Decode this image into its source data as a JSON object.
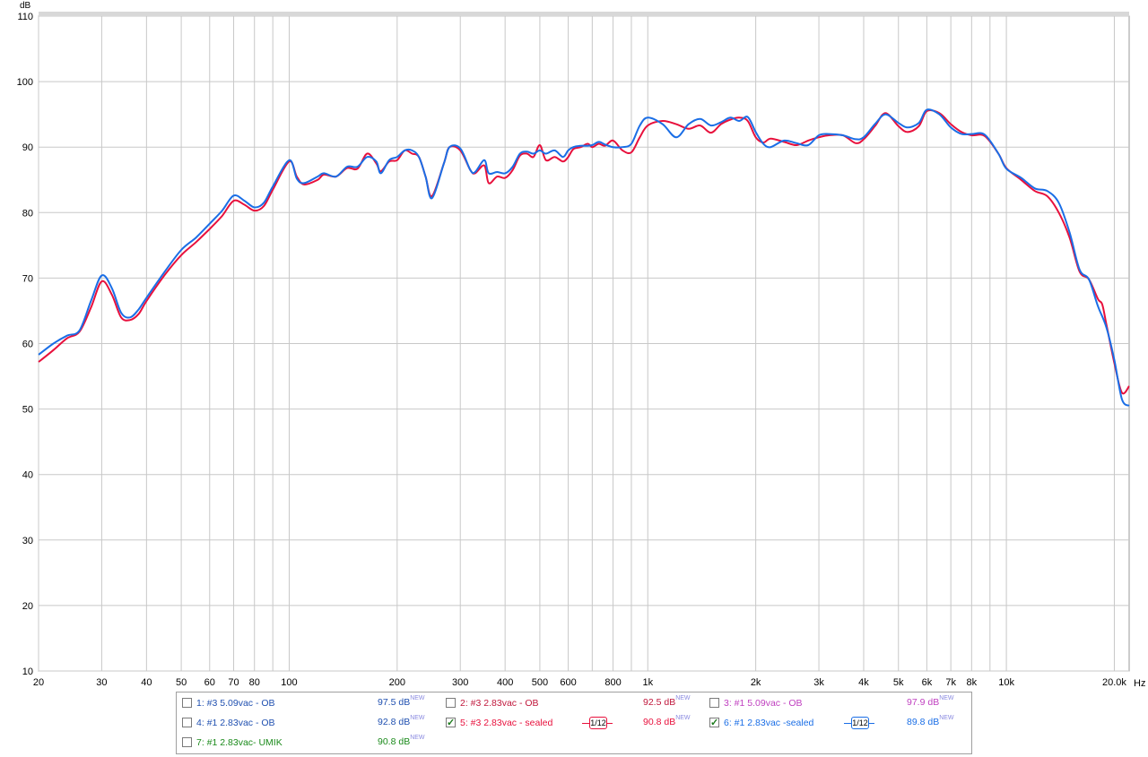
{
  "chart_data": {
    "type": "line",
    "ylabel": "dB",
    "xunit": "Hz",
    "xscale": "log",
    "xlim": [
      20,
      22000
    ],
    "ylim": [
      10,
      110
    ],
    "grid": true,
    "y_ticks": [
      10,
      20,
      30,
      40,
      50,
      60,
      70,
      80,
      90,
      100,
      110
    ],
    "x_ticks": [
      {
        "v": 20,
        "label": "20"
      },
      {
        "v": 30,
        "label": "30"
      },
      {
        "v": 40,
        "label": "40"
      },
      {
        "v": 50,
        "label": "50"
      },
      {
        "v": 60,
        "label": "60"
      },
      {
        "v": 70,
        "label": "70"
      },
      {
        "v": 80,
        "label": "80"
      },
      {
        "v": 100,
        "label": "100"
      },
      {
        "v": 200,
        "label": "200"
      },
      {
        "v": 300,
        "label": "300"
      },
      {
        "v": 400,
        "label": "400"
      },
      {
        "v": 500,
        "label": "500"
      },
      {
        "v": 600,
        "label": "600"
      },
      {
        "v": 800,
        "label": "800"
      },
      {
        "v": 1000,
        "label": "1k"
      },
      {
        "v": 2000,
        "label": "2k"
      },
      {
        "v": 3000,
        "label": "3k"
      },
      {
        "v": 4000,
        "label": "4k"
      },
      {
        "v": 5000,
        "label": "5k"
      },
      {
        "v": 6000,
        "label": "6k"
      },
      {
        "v": 7000,
        "label": "7k"
      },
      {
        "v": 8000,
        "label": "8k"
      },
      {
        "v": 10000,
        "label": "10k"
      },
      {
        "v": 20000,
        "label": "20.0k"
      }
    ],
    "x_gridlines": [
      20,
      30,
      40,
      50,
      60,
      70,
      80,
      90,
      100,
      200,
      300,
      400,
      500,
      600,
      700,
      800,
      900,
      1000,
      2000,
      3000,
      4000,
      5000,
      6000,
      7000,
      8000,
      9000,
      10000,
      20000
    ],
    "series": [
      {
        "name": "5: #3 2.83vac - sealed",
        "color": "#e8103c",
        "points": [
          [
            20,
            57.2
          ],
          [
            22,
            59
          ],
          [
            24,
            60.8
          ],
          [
            26,
            61.8
          ],
          [
            28,
            65.5
          ],
          [
            30,
            69.5
          ],
          [
            32,
            67.5
          ],
          [
            34,
            64
          ],
          [
            36,
            63.6
          ],
          [
            38,
            64.5
          ],
          [
            40,
            66.5
          ],
          [
            45,
            70.5
          ],
          [
            50,
            73.5
          ],
          [
            55,
            75.5
          ],
          [
            60,
            77.5
          ],
          [
            65,
            79.5
          ],
          [
            70,
            81.8
          ],
          [
            75,
            81.2
          ],
          [
            80,
            80.3
          ],
          [
            85,
            81
          ],
          [
            90,
            83.5
          ],
          [
            100,
            87.8
          ],
          [
            105,
            85.5
          ],
          [
            110,
            84.3
          ],
          [
            120,
            85
          ],
          [
            125,
            85.8
          ],
          [
            135,
            85.5
          ],
          [
            145,
            86.8
          ],
          [
            155,
            86.7
          ],
          [
            165,
            89
          ],
          [
            175,
            87.5
          ],
          [
            180,
            86.3
          ],
          [
            190,
            87.8
          ],
          [
            200,
            88
          ],
          [
            210,
            89.5
          ],
          [
            220,
            89
          ],
          [
            230,
            88.5
          ],
          [
            240,
            85.5
          ],
          [
            250,
            82.5
          ],
          [
            270,
            87.5
          ],
          [
            280,
            90
          ],
          [
            300,
            89.5
          ],
          [
            320,
            86.5
          ],
          [
            330,
            86
          ],
          [
            350,
            87.2
          ],
          [
            360,
            84.5
          ],
          [
            380,
            85.5
          ],
          [
            400,
            85.3
          ],
          [
            420,
            86.5
          ],
          [
            440,
            88.7
          ],
          [
            460,
            89
          ],
          [
            480,
            88.5
          ],
          [
            500,
            90.3
          ],
          [
            520,
            88
          ],
          [
            550,
            88.5
          ],
          [
            580,
            87.8
          ],
          [
            600,
            88.5
          ],
          [
            620,
            89.7
          ],
          [
            650,
            90
          ],
          [
            680,
            90.5
          ],
          [
            700,
            90
          ],
          [
            730,
            90.5
          ],
          [
            760,
            90.2
          ],
          [
            800,
            91
          ],
          [
            850,
            89.5
          ],
          [
            900,
            89.2
          ],
          [
            950,
            91.5
          ],
          [
            1000,
            93.3
          ],
          [
            1100,
            94
          ],
          [
            1200,
            93.5
          ],
          [
            1300,
            92.8
          ],
          [
            1400,
            93.3
          ],
          [
            1500,
            92.2
          ],
          [
            1600,
            93.5
          ],
          [
            1700,
            94.2
          ],
          [
            1800,
            94.5
          ],
          [
            1900,
            94
          ],
          [
            2000,
            91.5
          ],
          [
            2100,
            90.7
          ],
          [
            2200,
            91.3
          ],
          [
            2400,
            90.8
          ],
          [
            2600,
            90.3
          ],
          [
            2800,
            91
          ],
          [
            3000,
            91.5
          ],
          [
            3200,
            91.8
          ],
          [
            3500,
            91.8
          ],
          [
            3800,
            90.6
          ],
          [
            4000,
            91.2
          ],
          [
            4300,
            93.2
          ],
          [
            4600,
            95.2
          ],
          [
            5000,
            93.2
          ],
          [
            5300,
            92.3
          ],
          [
            5700,
            93.2
          ],
          [
            6000,
            95.5
          ],
          [
            6500,
            95.2
          ],
          [
            7000,
            93.5
          ],
          [
            7500,
            92.3
          ],
          [
            8000,
            91.8
          ],
          [
            8700,
            91.7
          ],
          [
            9500,
            89
          ],
          [
            10000,
            86.8
          ],
          [
            11000,
            85
          ],
          [
            12000,
            83.3
          ],
          [
            13000,
            82.5
          ],
          [
            14000,
            80
          ],
          [
            15000,
            76.2
          ],
          [
            16000,
            71
          ],
          [
            17000,
            69.8
          ],
          [
            18000,
            66.8
          ],
          [
            18500,
            66
          ],
          [
            19000,
            63
          ],
          [
            20000,
            57
          ],
          [
            21000,
            52.5
          ],
          [
            22000,
            53.5
          ]
        ]
      },
      {
        "name": "6: #1 2.83vac -sealed",
        "color": "#1a6ee6",
        "points": [
          [
            20,
            58.3
          ],
          [
            22,
            60
          ],
          [
            24,
            61.2
          ],
          [
            26,
            62
          ],
          [
            28,
            66.5
          ],
          [
            30,
            70.4
          ],
          [
            32,
            68.5
          ],
          [
            34,
            64.7
          ],
          [
            36,
            64
          ],
          [
            38,
            65.2
          ],
          [
            40,
            67
          ],
          [
            45,
            71
          ],
          [
            50,
            74.3
          ],
          [
            55,
            76.2
          ],
          [
            60,
            78.3
          ],
          [
            65,
            80.3
          ],
          [
            70,
            82.6
          ],
          [
            75,
            81.8
          ],
          [
            80,
            80.8
          ],
          [
            85,
            81.5
          ],
          [
            90,
            84
          ],
          [
            100,
            88
          ],
          [
            105,
            85.2
          ],
          [
            110,
            84.5
          ],
          [
            120,
            85.5
          ],
          [
            125,
            86
          ],
          [
            135,
            85.5
          ],
          [
            145,
            87
          ],
          [
            155,
            87
          ],
          [
            165,
            88.5
          ],
          [
            175,
            87.8
          ],
          [
            180,
            86
          ],
          [
            190,
            88
          ],
          [
            200,
            88.5
          ],
          [
            210,
            89.5
          ],
          [
            220,
            89.5
          ],
          [
            230,
            88.5
          ],
          [
            240,
            85.5
          ],
          [
            250,
            82.2
          ],
          [
            270,
            87.5
          ],
          [
            280,
            90
          ],
          [
            300,
            89.8
          ],
          [
            320,
            86.5
          ],
          [
            330,
            86.2
          ],
          [
            350,
            88
          ],
          [
            360,
            86
          ],
          [
            380,
            86.2
          ],
          [
            400,
            86
          ],
          [
            420,
            87
          ],
          [
            440,
            89
          ],
          [
            460,
            89.3
          ],
          [
            480,
            89
          ],
          [
            500,
            89.5
          ],
          [
            520,
            89
          ],
          [
            550,
            89.5
          ],
          [
            580,
            88.5
          ],
          [
            600,
            89.5
          ],
          [
            620,
            90
          ],
          [
            650,
            90.2
          ],
          [
            680,
            90.2
          ],
          [
            700,
            90.3
          ],
          [
            730,
            90.8
          ],
          [
            760,
            90.4
          ],
          [
            800,
            90
          ],
          [
            850,
            90
          ],
          [
            900,
            90.5
          ],
          [
            950,
            93.3
          ],
          [
            1000,
            94.5
          ],
          [
            1100,
            93.5
          ],
          [
            1200,
            91.5
          ],
          [
            1300,
            93.5
          ],
          [
            1400,
            94.3
          ],
          [
            1500,
            93.3
          ],
          [
            1600,
            93.8
          ],
          [
            1700,
            94.5
          ],
          [
            1800,
            94
          ],
          [
            1900,
            94.6
          ],
          [
            2000,
            92.3
          ],
          [
            2100,
            90.5
          ],
          [
            2200,
            90
          ],
          [
            2400,
            91
          ],
          [
            2600,
            90.6
          ],
          [
            2800,
            90.3
          ],
          [
            3000,
            91.8
          ],
          [
            3200,
            92
          ],
          [
            3500,
            91.8
          ],
          [
            3800,
            91.2
          ],
          [
            4000,
            91.5
          ],
          [
            4300,
            93.5
          ],
          [
            4600,
            95
          ],
          [
            5000,
            93.7
          ],
          [
            5300,
            93
          ],
          [
            5700,
            93.7
          ],
          [
            6000,
            95.7
          ],
          [
            6500,
            95
          ],
          [
            7000,
            93
          ],
          [
            7500,
            92
          ],
          [
            8000,
            92
          ],
          [
            8700,
            91.9
          ],
          [
            9500,
            89
          ],
          [
            10000,
            86.7
          ],
          [
            11000,
            85.3
          ],
          [
            12000,
            83.7
          ],
          [
            13000,
            83.3
          ],
          [
            14000,
            81.5
          ],
          [
            15000,
            77
          ],
          [
            16000,
            71.3
          ],
          [
            17000,
            69.8
          ],
          [
            18000,
            65.7
          ],
          [
            19000,
            62.5
          ],
          [
            20000,
            57.5
          ],
          [
            21000,
            51.5
          ],
          [
            22000,
            50.5
          ]
        ]
      }
    ]
  },
  "legend": {
    "items": [
      {
        "label": "1: #3  5.09vac - OB",
        "level": "97.5 dB",
        "sup": "NEW",
        "checked": false,
        "color": "#2050b0",
        "smoothing": ""
      },
      {
        "label": "2: #3 2.83vac - OB",
        "level": "92.5 dB",
        "sup": "NEW",
        "checked": false,
        "color": "#c0183c",
        "smoothing": ""
      },
      {
        "label": "3: #1 5.09vac - OB",
        "level": "97.9 dB",
        "sup": "NEW",
        "checked": false,
        "color": "#c040c0",
        "smoothing": ""
      },
      {
        "label": "4: #1  2.83vac - OB",
        "level": "92.8 dB",
        "sup": "NEW",
        "checked": false,
        "color": "#2050b0",
        "smoothing": ""
      },
      {
        "label": "5: #3 2.83vac - sealed",
        "level": "90.8 dB",
        "sup": "NEW",
        "checked": true,
        "color": "#e8103c",
        "smoothing": "1/12"
      },
      {
        "label": "6: #1 2.83vac -sealed",
        "level": "89.8 dB",
        "sup": "NEW",
        "checked": true,
        "color": "#1a6ee6",
        "smoothing": "1/12"
      },
      {
        "label": "7: #1 2.83vac- UMIK",
        "level": "90.8 dB",
        "sup": "NEW",
        "checked": false,
        "color": "#1a8a1a",
        "smoothing": ""
      }
    ]
  }
}
